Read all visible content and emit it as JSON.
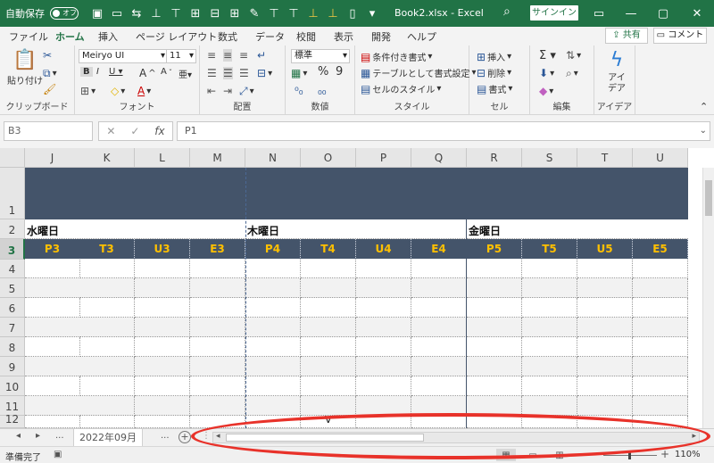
{
  "titlebar": {
    "autosave_label": "自動保存",
    "autosave_state": "オフ",
    "filename": "Book2.xlsx  -  Excel",
    "signin": "サインイン"
  },
  "menu": {
    "tabs": [
      "ファイル",
      "ホーム",
      "挿入",
      "ページ レイアウト",
      "数式",
      "データ",
      "校閲",
      "表示",
      "開発",
      "ヘルプ"
    ],
    "active_index": 1,
    "share": "共有",
    "comment": "コメント"
  },
  "ribbon": {
    "clipboard": {
      "paste": "貼り付け",
      "label": "クリップボード"
    },
    "font": {
      "name": "Meiryo UI",
      "size": "11",
      "label": "フォント"
    },
    "alignment": {
      "label": "配置"
    },
    "number": {
      "format": "標準",
      "label": "数値"
    },
    "styles": {
      "conditional": "条件付き書式",
      "table": "テーブルとして書式設定",
      "cell_styles": "セルのスタイル",
      "label": "スタイル"
    },
    "cells": {
      "insert": "挿入",
      "delete": "削除",
      "format": "書式",
      "label": "セル"
    },
    "editing": {
      "label": "編集"
    },
    "ideas": {
      "button": "アイデア",
      "label": "アイデア"
    }
  },
  "formula_bar": {
    "name_box": "B3",
    "formula": "P1"
  },
  "grid": {
    "columns": [
      "J",
      "K",
      "L",
      "M",
      "N",
      "O",
      "P",
      "Q",
      "R",
      "S",
      "T",
      "U"
    ],
    "rows": [
      "1",
      "2",
      "3",
      "4",
      "5",
      "6",
      "7",
      "8",
      "9",
      "10",
      "11",
      "12"
    ],
    "selected_row": "3",
    "days": [
      "水曜日",
      "木曜日",
      "金曜日"
    ],
    "header_cells": [
      "P3",
      "T3",
      "U3",
      "E3",
      "P4",
      "T4",
      "U4",
      "E4",
      "P5",
      "T5",
      "U5",
      "E5"
    ],
    "row12_mark": "V"
  },
  "sheets": {
    "more_left": "...",
    "active": "2022年09月",
    "more_right": "..."
  },
  "status": {
    "ready": "準備完了",
    "zoom": "110%"
  },
  "colors": {
    "excel_green": "#217346",
    "header_navy": "#44546a",
    "header_text": "#ffc000",
    "annotation": "#e8322a"
  }
}
